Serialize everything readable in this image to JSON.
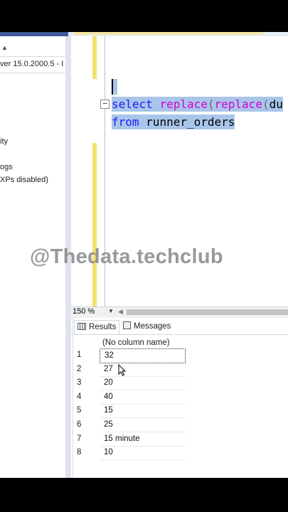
{
  "explorer": {
    "server_label": "ver 15.0.2000.5 - I",
    "items": [
      "ity",
      "ogs",
      "XPs disabled)"
    ]
  },
  "editor": {
    "line1": {
      "kw1": "select",
      "fn1": "replace",
      "p1": "(",
      "fn2": "replace",
      "p2": "(",
      "tail": "du"
    },
    "line2": {
      "kw": "from",
      "ident": "runner_orders"
    }
  },
  "watermark": "@Thedata.techclub",
  "zoom": {
    "level": "150 %"
  },
  "results": {
    "tabs": {
      "results": "Results",
      "messages": "Messages"
    },
    "column_header": "(No column name)",
    "rows": [
      {
        "n": "1",
        "v": "32"
      },
      {
        "n": "2",
        "v": "27"
      },
      {
        "n": "3",
        "v": "20"
      },
      {
        "n": "4",
        "v": "40"
      },
      {
        "n": "5",
        "v": "15"
      },
      {
        "n": "6",
        "v": "25"
      },
      {
        "n": "7",
        "v": "15 minute"
      },
      {
        "n": "8",
        "v": "10"
      }
    ]
  },
  "colors": {
    "selection": "#a9c6ea",
    "keyword": "#1a1aff",
    "function": "#d100d1",
    "change_bar": "#f3e36b"
  }
}
